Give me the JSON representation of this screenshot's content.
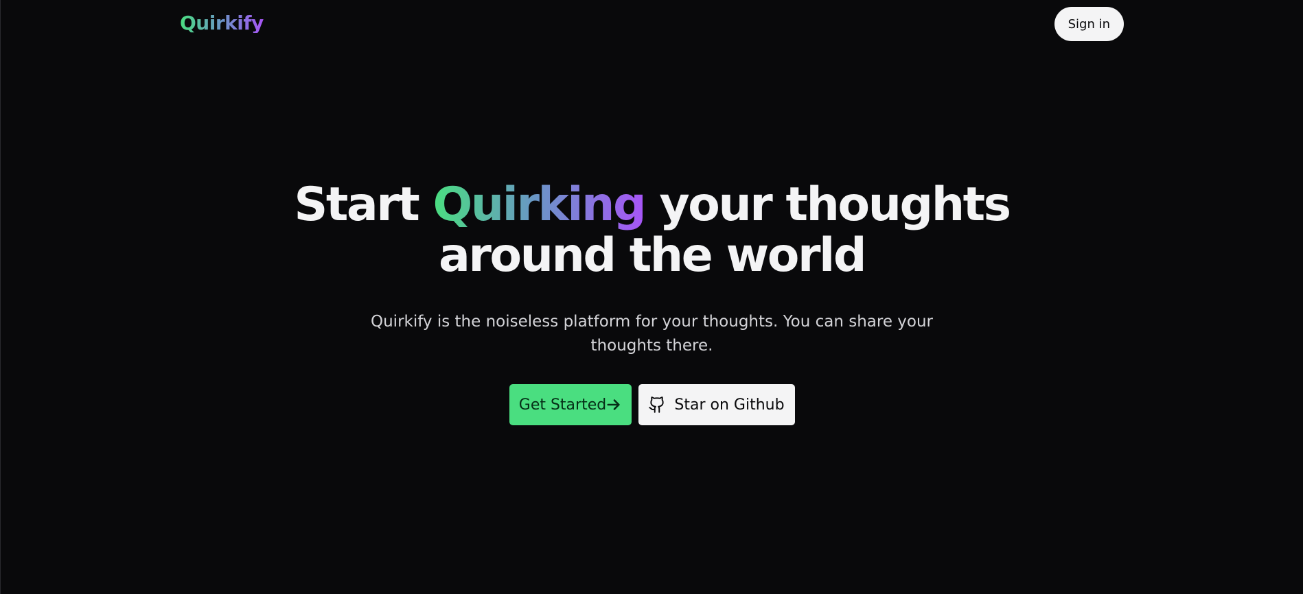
{
  "header": {
    "logo_text": "Quirkify",
    "signin_label": "Sign in"
  },
  "hero": {
    "headline_prefix": "Start ",
    "headline_highlight": "Quirking",
    "headline_suffix": " your thoughts",
    "headline_line2": "around the world",
    "subheadline": "Quirkify is the noiseless platform for your thoughts. You can share your thoughts there.",
    "primary_cta_label": "Get Started",
    "primary_cta_icon": "arrow-right-icon",
    "secondary_cta_label": "Star on Github",
    "secondary_cta_icon": "github-icon"
  },
  "colors": {
    "background": "#09090b",
    "accent_green": "#4ade80",
    "accent_purple": "#a855f7",
    "text_light": "#f4f4f5"
  }
}
